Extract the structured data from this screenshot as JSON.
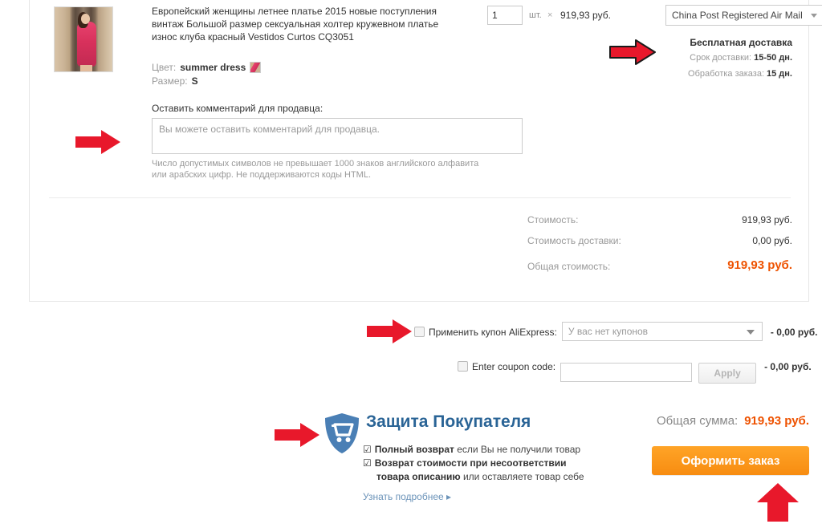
{
  "order_card": {
    "product": {
      "thumbnail_alt": "red-summer-dress-photo",
      "title": "Европейский женщины летнее платье 2015 новые поступления винтаж Большой размер сексуальная холтер кружевном платье износ клуба красный Vestidos Curtos CQ3051",
      "attributes": [
        {
          "label": "Цвет:",
          "value": "summer dress",
          "has_swatch": true
        },
        {
          "label": "Размер:",
          "value": "S",
          "has_swatch": false
        }
      ]
    },
    "quantity": {
      "value": "1",
      "unit": "шт.",
      "multiply_symbol": "×",
      "unit_price": "919,93 руб."
    },
    "shipping": {
      "method": "China Post Registered Air Mail",
      "free_label": "Бесплатная доставка",
      "delivery_time_label": "Срок доставки:",
      "delivery_time_value": "15-50 дн.",
      "processing_label": "Обработка заказа:",
      "processing_value": "15 дн."
    },
    "comment": {
      "label": "Оставить комментарий для продавца:",
      "placeholder": "Вы можете оставить комментарий для продавца.",
      "value": "",
      "hint": "Число допустимых символов не превышает 1000 знаков английского алфавита или арабских цифр. Не поддерживаются коды HTML."
    },
    "totals": [
      {
        "label": "Стоимость:",
        "value": "919,93 руб."
      },
      {
        "label": "Стоимость доставки:",
        "value": "0,00 руб."
      }
    ],
    "grand": {
      "label": "Общая стоимость:",
      "value": "919,93 руб."
    }
  },
  "coupons": {
    "aliexpress": {
      "label": "Применить купон AliExpress:",
      "select_value": "У вас нет купонов",
      "amount": "- 0,00 руб.",
      "checked": false
    },
    "code": {
      "label": "Enter coupon code:",
      "input_value": "",
      "apply_label": "Apply",
      "amount": "- 0,00 руб.",
      "checked": false
    }
  },
  "buyer_protection": {
    "icon": "shield-cart-icon",
    "title": "Защита Покупателя",
    "check_glyph": "☑",
    "items": [
      {
        "bold": "Полный возврат",
        "rest": " если Вы не получили товар"
      },
      {
        "bold": "Возврат стоимости при несоответствии",
        "rest": ""
      },
      {
        "bold": "товара описанию",
        "rest": " или оставляете товар себе"
      }
    ],
    "more_link": "Узнать подробнее ▸"
  },
  "summary": {
    "grand_total_label": "Общая сумма:",
    "grand_total_value": "919,93 руб.",
    "place_order_label": "Оформить заказ"
  },
  "annotations": {
    "arrow_color": "#e8182b",
    "arrows": [
      {
        "name": "arrow-to-shipping",
        "direction": "right"
      },
      {
        "name": "arrow-to-comment",
        "direction": "right"
      },
      {
        "name": "arrow-to-coupon-checkbox",
        "direction": "right"
      },
      {
        "name": "arrow-to-buyer-protection",
        "direction": "right"
      },
      {
        "name": "arrow-to-place-order",
        "direction": "up"
      }
    ]
  },
  "colors": {
    "accent_orange": "#ee5200",
    "button_orange": "#f78c11",
    "protection_blue": "#2a6496",
    "shield_blue": "#4a7fb5",
    "arrow_red": "#e8182b"
  }
}
